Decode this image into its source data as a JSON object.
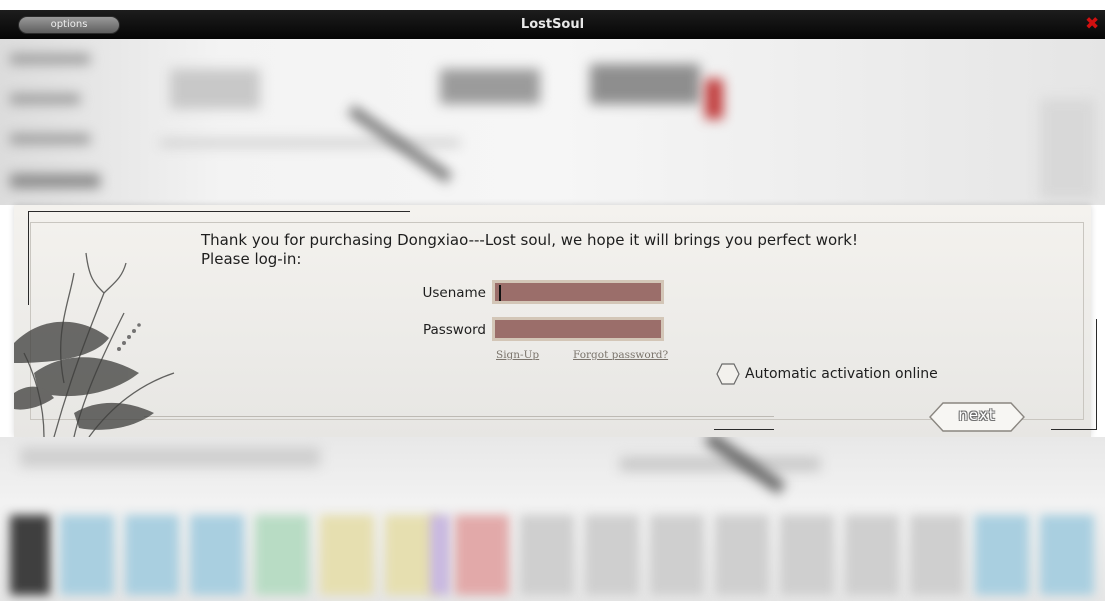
{
  "window": {
    "title": "LostSoul",
    "options_label": "options",
    "close_glyph": "✖"
  },
  "dialog": {
    "message_line1": "Thank you for purchasing Dongxiao---Lost soul, we hope it will brings you perfect work!",
    "message_line2": "Please log-in:",
    "username_label": "Usename",
    "username_value": "",
    "password_label": "Password",
    "password_value": "",
    "signup_link": "Sign-Up",
    "forgot_link": "Forgot password?",
    "auto_activation_label": "Automatic activation online",
    "auto_activation_checked": false,
    "next_label": "next"
  },
  "colors": {
    "title_bar": "#0a0a0a",
    "input_fill": "#9b6e6a",
    "input_border": "#d3c6b7",
    "close_red": "#d01010",
    "panel_bg": "#efedea"
  },
  "icons": {
    "close": "close-icon",
    "checkbox": "hexagon-checkbox-icon",
    "next_arrow_button": "arrow-button-shape",
    "decoration": "ink-lotus-painting"
  }
}
